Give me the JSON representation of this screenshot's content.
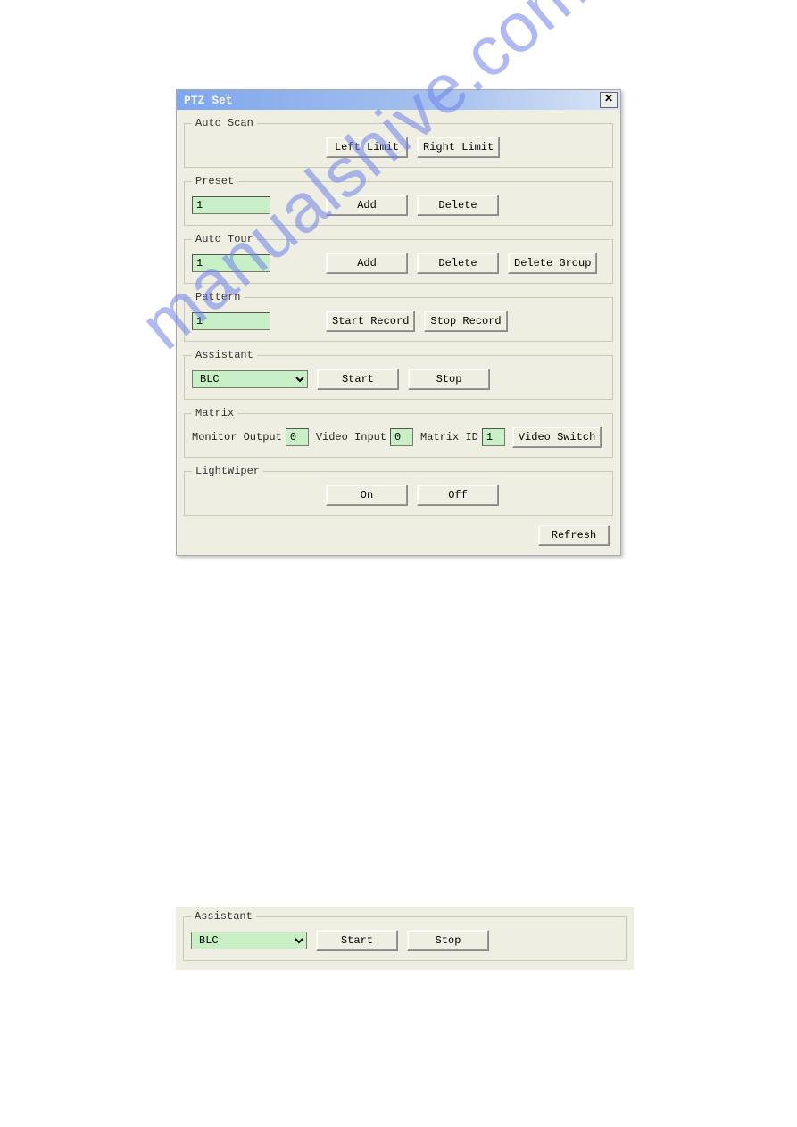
{
  "watermark": "manualshive.com",
  "dialog": {
    "title": "PTZ Set",
    "close": "✕",
    "auto_scan": {
      "legend": "Auto Scan",
      "left_limit": "Left Limit",
      "right_limit": "Right Limit"
    },
    "preset": {
      "legend": "Preset",
      "value": "1",
      "add": "Add",
      "delete": "Delete"
    },
    "auto_tour": {
      "legend": "Auto Tour",
      "value": "1",
      "add": "Add",
      "delete": "Delete",
      "delete_group": "Delete Group"
    },
    "pattern": {
      "legend": "Pattern",
      "value": "1",
      "start_record": "Start Record",
      "stop_record": "Stop Record"
    },
    "assistant": {
      "legend": "Assistant",
      "value": "BLC",
      "start": "Start",
      "stop": "Stop"
    },
    "matrix": {
      "legend": "Matrix",
      "monitor_output_label": "Monitor Output",
      "monitor_output_value": "0",
      "video_input_label": "Video Input",
      "video_input_value": "0",
      "matrix_id_label": "Matrix ID",
      "matrix_id_value": "1",
      "video_switch": "Video Switch"
    },
    "lightwiper": {
      "legend": "LightWiper",
      "on": "On",
      "off": "Off"
    },
    "refresh": "Refresh"
  },
  "panel2": {
    "legend": "Assistant",
    "value": "BLC",
    "start": "Start",
    "stop": "Stop"
  }
}
